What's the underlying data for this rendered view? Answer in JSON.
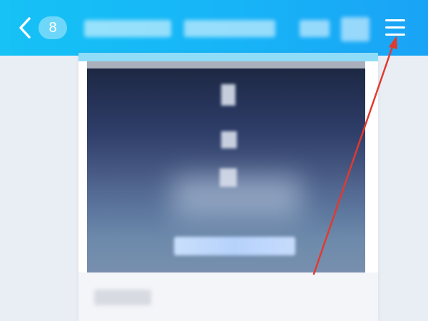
{
  "header": {
    "unread_count": "8",
    "title": "",
    "back_icon": "chevron-left-icon",
    "menu_icon": "hamburger-menu-icon"
  },
  "message_card": {
    "link_text": "",
    "source_text": ""
  },
  "annotation": {
    "type": "arrow",
    "color": "#e03a2f",
    "points_to": "menu-button"
  },
  "colors": {
    "header_start": "#16c2f6",
    "header_end": "#1aa3f6",
    "page_background": "#e9edf4",
    "link_blue": "#b6d2fb"
  }
}
